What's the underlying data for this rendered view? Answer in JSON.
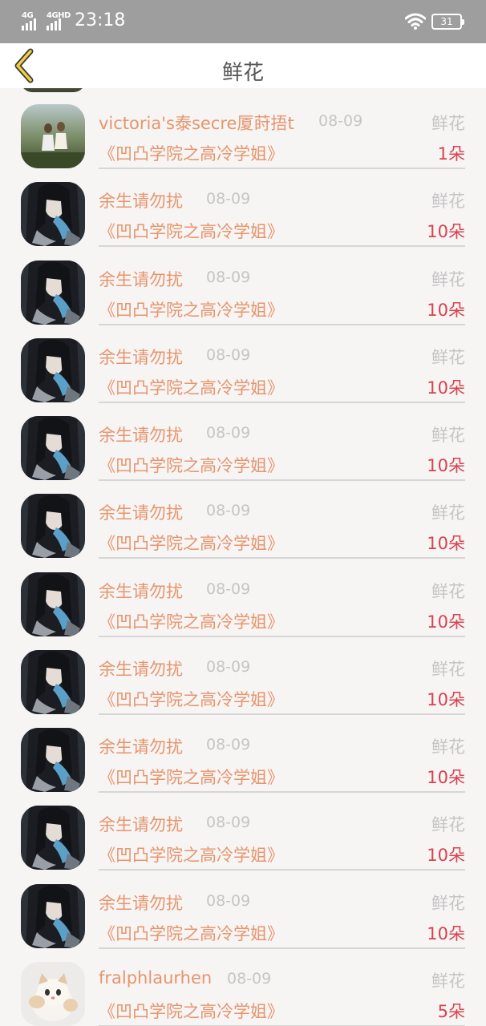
{
  "status_bar": {
    "network_1": "4G",
    "network_2": "4GHD",
    "time": "23:18",
    "battery": "31"
  },
  "nav": {
    "title": "鲜花",
    "back_icon": "chevron-left-icon"
  },
  "list": [
    {
      "avatar": "photo-avatar",
      "name": "victoria's泰secre厦莳捂t",
      "date": "08-09",
      "gift": "鲜花",
      "book": "《凹凸学院之高冷学姐》",
      "count": "1朵"
    },
    {
      "avatar": "anime-avatar",
      "name": "余生请勿扰",
      "date": "08-09",
      "gift": "鲜花",
      "book": "《凹凸学院之高冷学姐》",
      "count": "10朵"
    },
    {
      "avatar": "anime-avatar",
      "name": "余生请勿扰",
      "date": "08-09",
      "gift": "鲜花",
      "book": "《凹凸学院之高冷学姐》",
      "count": "10朵"
    },
    {
      "avatar": "anime-avatar",
      "name": "余生请勿扰",
      "date": "08-09",
      "gift": "鲜花",
      "book": "《凹凸学院之高冷学姐》",
      "count": "10朵"
    },
    {
      "avatar": "anime-avatar",
      "name": "余生请勿扰",
      "date": "08-09",
      "gift": "鲜花",
      "book": "《凹凸学院之高冷学姐》",
      "count": "10朵"
    },
    {
      "avatar": "anime-avatar",
      "name": "余生请勿扰",
      "date": "08-09",
      "gift": "鲜花",
      "book": "《凹凸学院之高冷学姐》",
      "count": "10朵"
    },
    {
      "avatar": "anime-avatar",
      "name": "余生请勿扰",
      "date": "08-09",
      "gift": "鲜花",
      "book": "《凹凸学院之高冷学姐》",
      "count": "10朵"
    },
    {
      "avatar": "anime-avatar",
      "name": "余生请勿扰",
      "date": "08-09",
      "gift": "鲜花",
      "book": "《凹凸学院之高冷学姐》",
      "count": "10朵"
    },
    {
      "avatar": "anime-avatar",
      "name": "余生请勿扰",
      "date": "08-09",
      "gift": "鲜花",
      "book": "《凹凸学院之高冷学姐》",
      "count": "10朵"
    },
    {
      "avatar": "anime-avatar",
      "name": "余生请勿扰",
      "date": "08-09",
      "gift": "鲜花",
      "book": "《凹凸学院之高冷学姐》",
      "count": "10朵"
    },
    {
      "avatar": "anime-avatar",
      "name": "余生请勿扰",
      "date": "08-09",
      "gift": "鲜花",
      "book": "《凹凸学院之高冷学姐》",
      "count": "10朵"
    },
    {
      "avatar": "cat-avatar",
      "name": "fralphlaurhen",
      "date": "08-09",
      "gift": "鲜花",
      "book": "《凹凸学院之高冷学姐》",
      "count": "5朵"
    }
  ]
}
